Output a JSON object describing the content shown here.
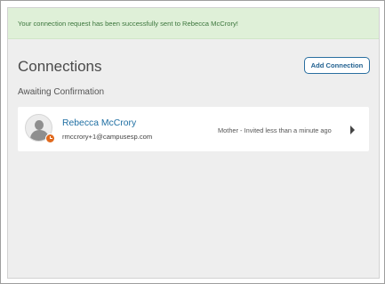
{
  "alert": {
    "message": "Your connection request has been successfully sent to Rebecca McCrory!"
  },
  "header": {
    "title": "Connections",
    "add_button_label": "Add Connection"
  },
  "awaiting": {
    "heading": "Awaiting Confirmation",
    "items": [
      {
        "name": "Rebecca McCrory",
        "email": "rmccrory+1@campusesp.com",
        "relation_status": "Mother - Invited less than a minute ago",
        "avatar_icon": "user-silhouette-icon",
        "badge_icon": "clock-icon",
        "badge_color": "#e06a1e"
      }
    ]
  },
  "colors": {
    "alert_bg": "#dff0d8",
    "alert_text": "#3c763d",
    "accent": "#1f6fa3",
    "panel_bg": "#eeeeee"
  }
}
